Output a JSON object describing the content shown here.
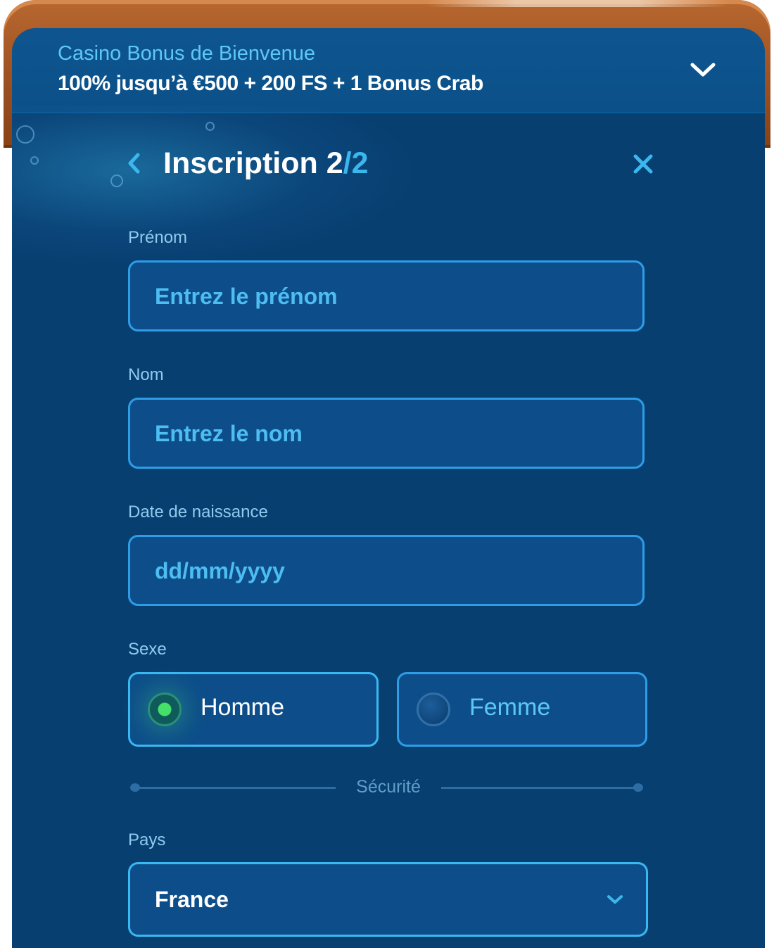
{
  "banner": {
    "subtitle": "Casino Bonus de Bienvenue",
    "title": "100% jusqu’à €500 + 200 FS + 1 Bonus Crab",
    "toggle_icon": "chevron-down-icon"
  },
  "header": {
    "title_main": "Inscription 2",
    "title_slash": "/",
    "title_total": "2",
    "back_icon": "chevron-left-icon",
    "close_icon": "close-icon"
  },
  "form": {
    "first_name": {
      "label": "Prénom",
      "placeholder": "Entrez le prénom",
      "value": ""
    },
    "last_name": {
      "label": "Nom",
      "placeholder": "Entrez le nom",
      "value": ""
    },
    "birth_date": {
      "label": "Date de naissance",
      "placeholder": "dd/mm/yyyy",
      "value": ""
    },
    "gender": {
      "label": "Sexe",
      "options": [
        {
          "label": "Homme",
          "selected": true
        },
        {
          "label": "Femme",
          "selected": false
        }
      ]
    },
    "section_divider": "Sécurité",
    "country": {
      "label": "Pays",
      "value": "France",
      "icon": "chevron-down-icon"
    }
  },
  "colors": {
    "panel_bg": "#083f71",
    "field_bg": "#0d4e8a",
    "accent": "#3ab8f2",
    "placeholder": "#4dbdf2",
    "label": "#8fcbee",
    "radio_selected": "#45e06a",
    "frame": "#9a4f21"
  }
}
